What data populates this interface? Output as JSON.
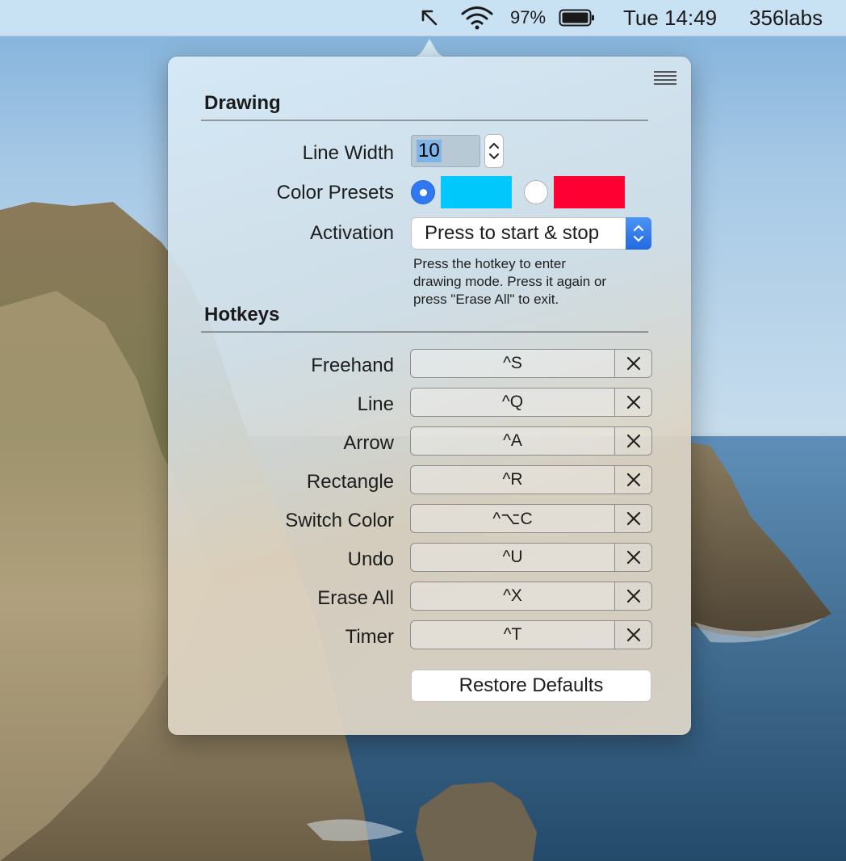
{
  "menubar": {
    "battery_percent": "97%",
    "date_time": "Tue 14:49",
    "user": "356labs",
    "icons": [
      "pointer-arrow-icon",
      "wifi-icon",
      "battery-icon"
    ]
  },
  "panel": {
    "drawing_title": "Drawing",
    "line_width_label": "Line Width",
    "line_width_value": "10",
    "color_presets_label": "Color Presets",
    "color_presets": [
      {
        "color": "#00c8fb",
        "selected": true
      },
      {
        "color": "#ff0033",
        "selected": false
      }
    ],
    "activation_label": "Activation",
    "activation_value": "Press to start & stop",
    "activation_help": [
      "Press the hotkey to enter",
      "drawing mode. Press it again or",
      "press \"Erase All\" to exit."
    ],
    "hotkeys_title": "Hotkeys",
    "hotkeys": [
      {
        "label": "Freehand",
        "key": "^S"
      },
      {
        "label": "Line",
        "key": "^Q"
      },
      {
        "label": "Arrow",
        "key": "^A"
      },
      {
        "label": "Rectangle",
        "key": "^R"
      },
      {
        "label": "Switch Color",
        "key": "^⌥C"
      },
      {
        "label": "Undo",
        "key": "^U"
      },
      {
        "label": "Erase All",
        "key": "^X"
      },
      {
        "label": "Timer",
        "key": "^T"
      }
    ],
    "restore_label": "Restore Defaults"
  },
  "colors": {
    "accent": "#2f78f2",
    "menubar": "#cee4f4"
  }
}
